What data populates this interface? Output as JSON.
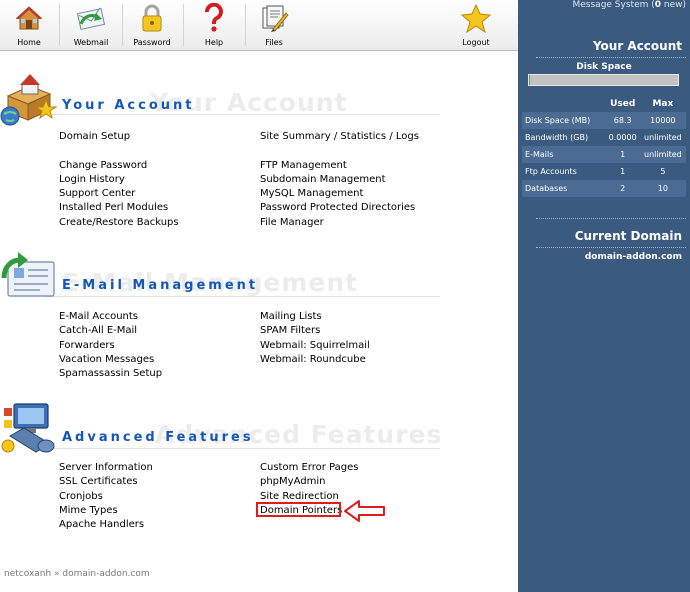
{
  "toolbar": {
    "items": [
      {
        "label": "Home",
        "icon": "house-icon"
      },
      {
        "label": "Webmail",
        "icon": "envelope-icon"
      },
      {
        "label": "Password",
        "icon": "padlock-icon"
      },
      {
        "label": "Help",
        "icon": "question-mark-icon"
      },
      {
        "label": "Files",
        "icon": "file-manager-icon"
      },
      {
        "label": "Logout",
        "icon": "star-icon"
      }
    ]
  },
  "sections": {
    "account": {
      "title": "Your Account",
      "ghost": "Your Account",
      "icon": "house-box-globe-icon",
      "col1": [
        "Domain Setup",
        "",
        "Change Password",
        "Login History",
        "Support Center",
        "Installed Perl Modules",
        "Create/Restore Backups"
      ],
      "col2": [
        "Site Summary / Statistics / Logs",
        "",
        "FTP Management",
        "Subdomain Management",
        "MySQL Management",
        "Password Protected Directories",
        "File Manager"
      ]
    },
    "email": {
      "title": "E-Mail Management",
      "ghost": "E-Mail Management",
      "icon": "email-card-arrow-icon",
      "col1": [
        "E-Mail Accounts",
        "Catch-All E-Mail",
        "Forwarders",
        "Vacation Messages",
        "Spamassassin Setup"
      ],
      "col2": [
        "Mailing Lists",
        "SPAM Filters",
        "Webmail: Squirrelmail",
        "Webmail: Roundcube"
      ]
    },
    "advanced": {
      "title": "Advanced Features",
      "ghost": "Advanced Features",
      "icon": "tools-monitor-icon",
      "col1": [
        "Server Information",
        "SSL Certificates",
        "Cronjobs",
        "Mime Types",
        "Apache Handlers"
      ],
      "col2": [
        "Custom Error Pages",
        "phpMyAdmin",
        "Site Redirection",
        "Domain Pointers"
      ]
    }
  },
  "footer": {
    "breadcrumb": "netcoxanh » domain-addon.com"
  },
  "sidebar": {
    "message_system": {
      "label": "Message System (",
      "count": "0",
      "suffix": " new)"
    },
    "your_account": "Your Account",
    "disk_space_label": "Disk Space",
    "disk_space_fill_fraction": 0.0068,
    "stats_headers": [
      "",
      "Used",
      "Max"
    ],
    "stats": [
      {
        "label": "Disk Space (MB)",
        "used": "68.3",
        "max": "10000"
      },
      {
        "label": "Bandwidth (GB)",
        "used": "0.0000",
        "max": "unlimited"
      },
      {
        "label": "E-Mails",
        "used": "1",
        "max": "unlimited"
      },
      {
        "label": "Ftp Accounts",
        "used": "1",
        "max": "5"
      },
      {
        "label": "Databases",
        "used": "2",
        "max": "10"
      }
    ],
    "current_domain_label": "Current Domain",
    "current_domain": "domain-addon.com"
  },
  "colors": {
    "sidebar_bg": "#3a5a80",
    "section_title": "#1457b8",
    "highlight": "#e01c1c"
  }
}
